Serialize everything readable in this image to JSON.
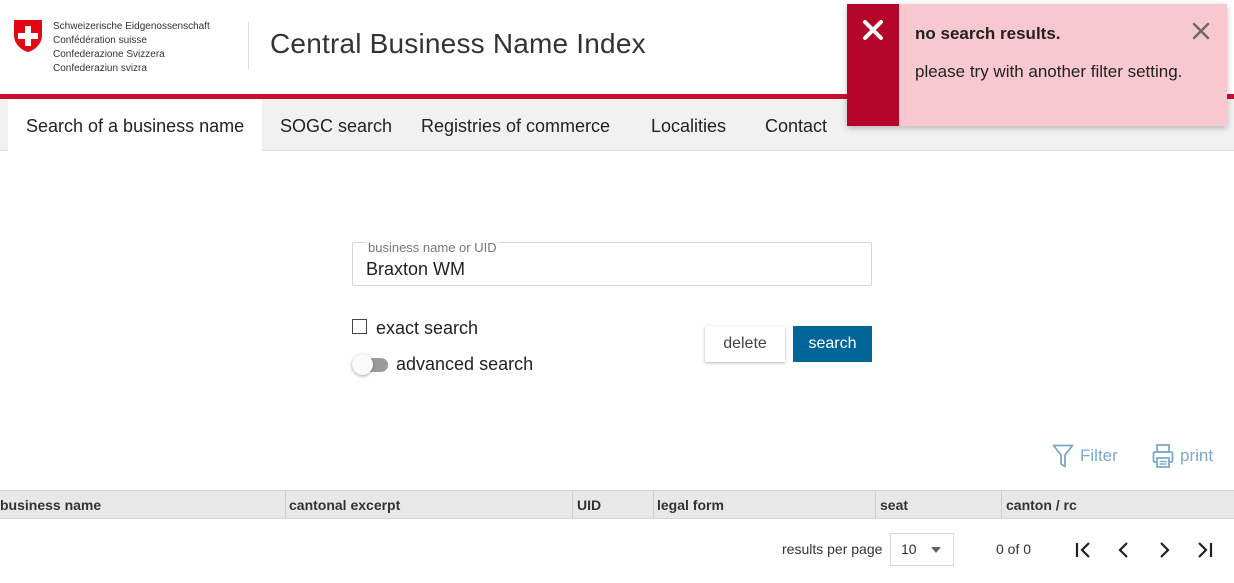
{
  "header": {
    "confederation_lines": [
      "Schweizerische Eidgenossenschaft",
      "Confédération suisse",
      "Confederazione Svizzera",
      "Confederaziun svizra"
    ],
    "app_title": "Central Business Name Index",
    "logo_icon": "swiss-cross-shield-icon"
  },
  "colors": {
    "brand_red": "#c8102e",
    "toast_accent": "#b5052a",
    "toast_bg": "#f8c8d0",
    "primary_button": "#006699",
    "link_blue": "#7aa9cc"
  },
  "nav": {
    "tabs": [
      {
        "label": "Search of a business name",
        "active": true
      },
      {
        "label": "SOGC search",
        "active": false
      },
      {
        "label": "Registries of commerce",
        "active": false
      },
      {
        "label": "Localities",
        "active": false
      },
      {
        "label": "Contact",
        "active": false
      }
    ]
  },
  "toast": {
    "title": "no search results.",
    "message": "please try with another filter setting.",
    "status_icon": "error-x-icon",
    "close_icon": "close-icon"
  },
  "search": {
    "label": "business name or UID",
    "value": "Braxton WM",
    "exact_label": "exact search",
    "exact_checked": false,
    "advanced_label": "advanced search",
    "advanced_on": false,
    "delete_label": "delete",
    "search_label": "search"
  },
  "actions": {
    "filter_label": "Filter",
    "print_label": "print",
    "filter_icon": "funnel-icon",
    "print_icon": "printer-icon"
  },
  "table": {
    "columns": [
      "business name",
      "cantonal excerpt",
      "UID",
      "legal form",
      "seat",
      "canton / rc"
    ],
    "rows": []
  },
  "pagination": {
    "per_page_label": "results per page",
    "per_page": "10",
    "range": "0 of 0"
  }
}
